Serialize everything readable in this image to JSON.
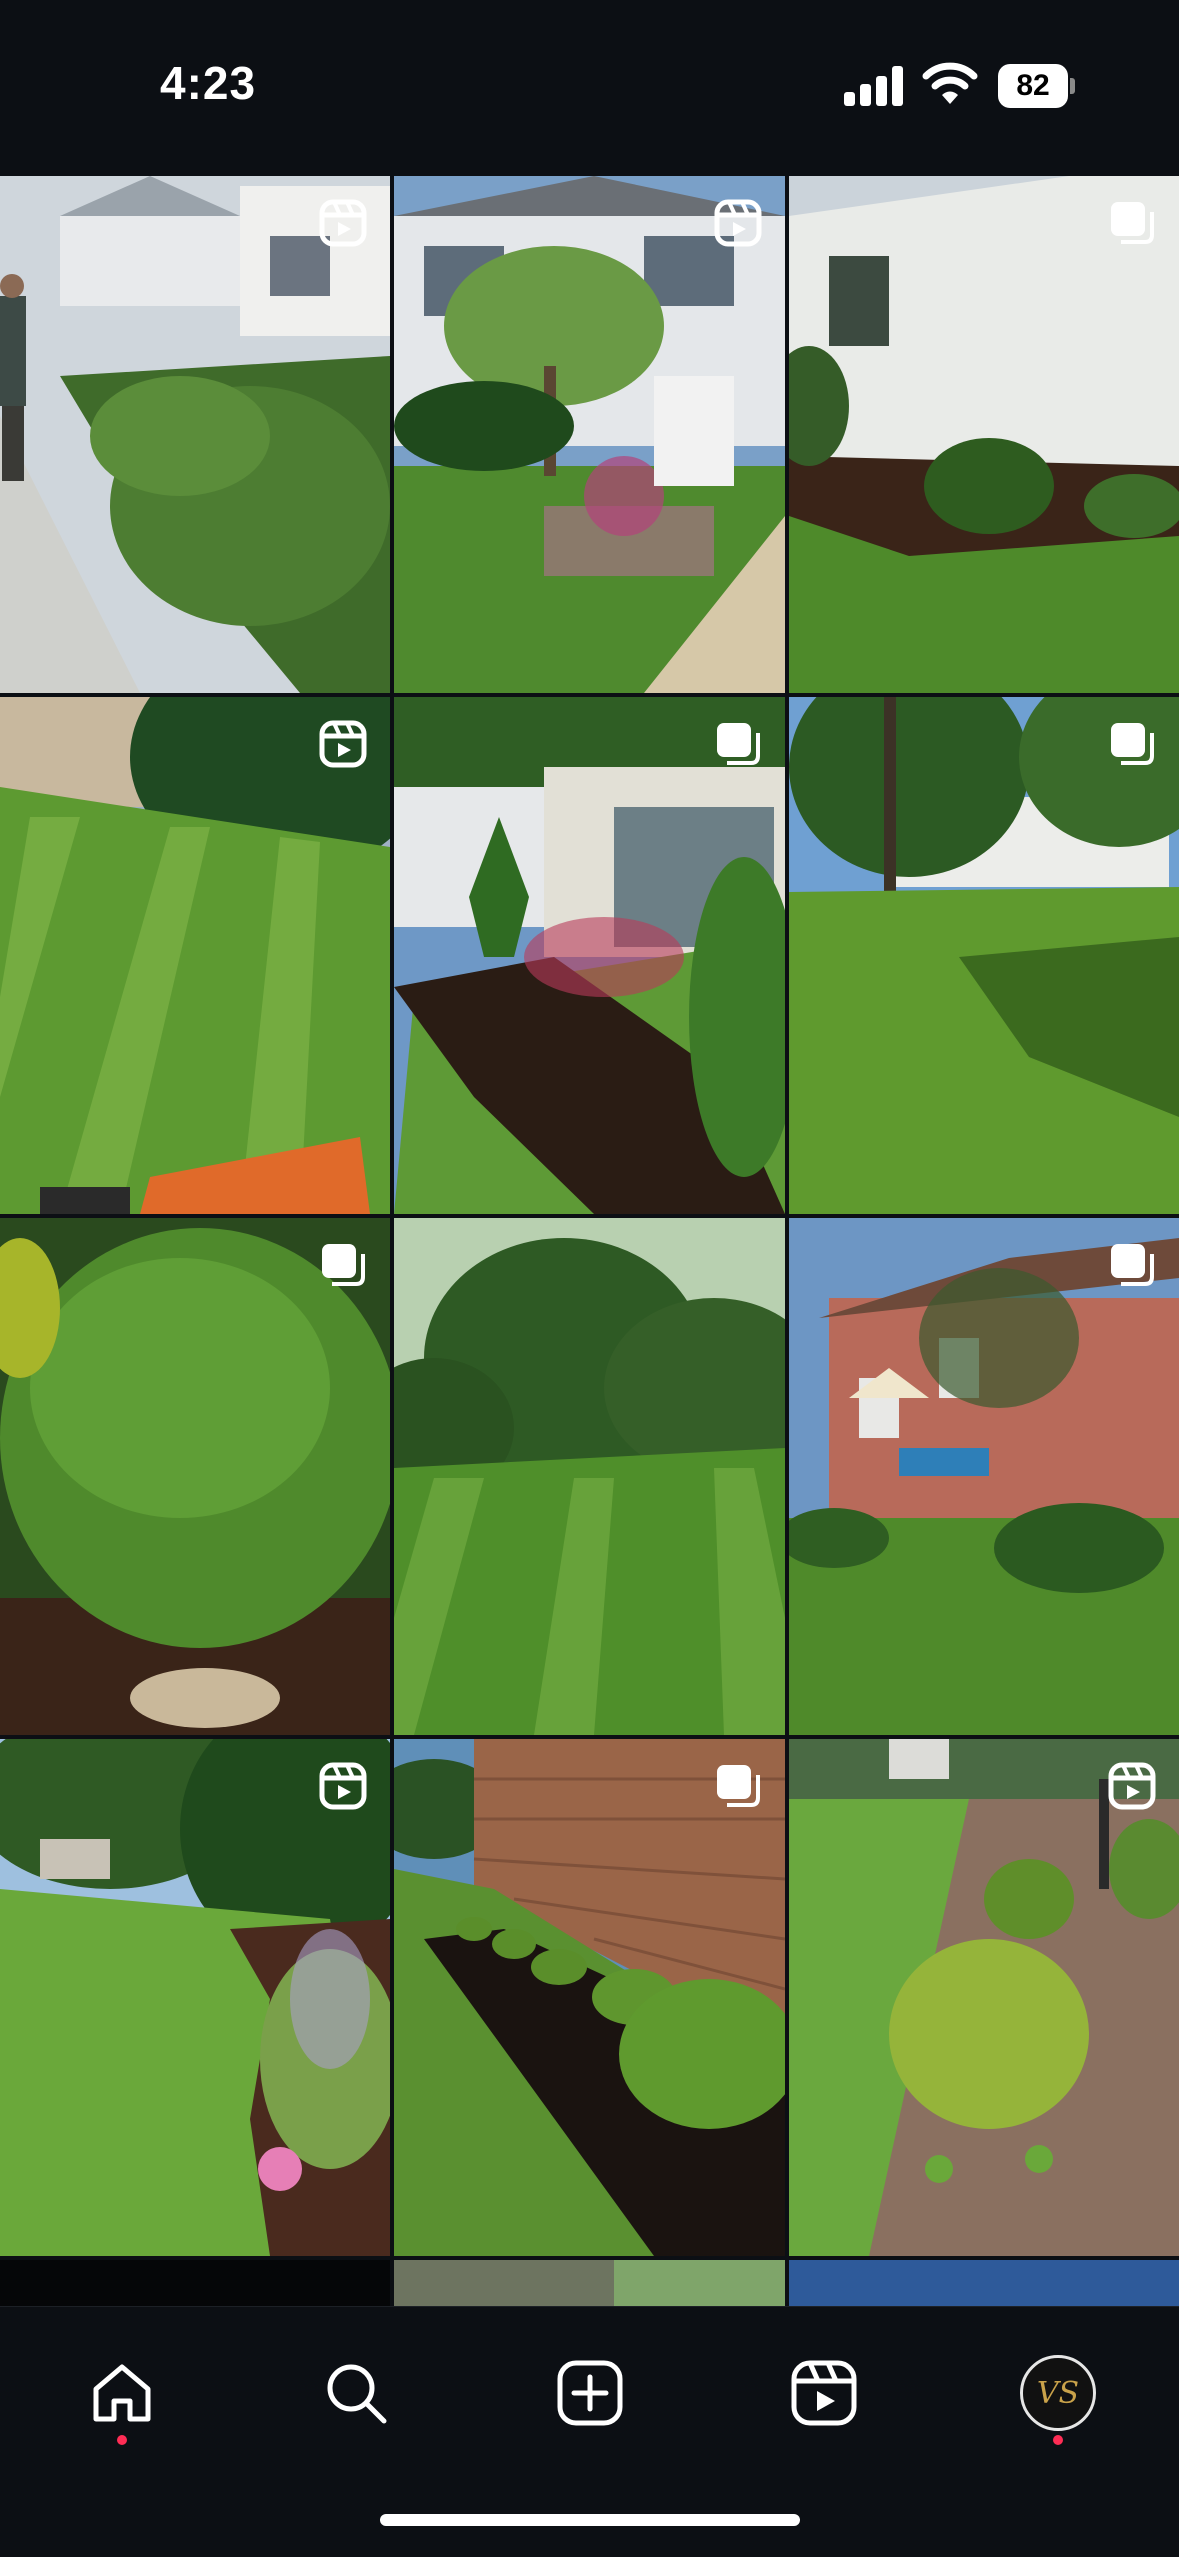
{
  "status_bar": {
    "time": "4:23",
    "battery_level": "82"
  },
  "grid": {
    "tiles": [
      {
        "badge": "reels-icon",
        "scene": "hedge-sidewalk"
      },
      {
        "badge": "reels-icon",
        "scene": "house-tree-front"
      },
      {
        "badge": "carousel-icon",
        "scene": "white-siding-shrub"
      },
      {
        "badge": "reels-icon",
        "scene": "striped-lawn-trees"
      },
      {
        "badge": "carousel-icon",
        "scene": "house-mulch-bed"
      },
      {
        "badge": "carousel-icon",
        "scene": "lawn-house-shade"
      },
      {
        "badge": "carousel-icon",
        "scene": "evergreen-shrub"
      },
      {
        "badge": "none",
        "scene": "striped-lawn-pines"
      },
      {
        "badge": "carousel-icon",
        "scene": "brick-house-shrubs"
      },
      {
        "badge": "reels-icon",
        "scene": "curved-garden-bed"
      },
      {
        "badge": "carousel-icon",
        "scene": "brick-wall-boxwoods"
      },
      {
        "badge": "reels-icon",
        "scene": "round-shrub-bed"
      }
    ]
  },
  "bottom_nav": {
    "items": [
      "home-icon",
      "search-icon",
      "create-icon",
      "reels-icon",
      "profile-avatar"
    ],
    "avatar_monogram": "VS"
  },
  "colors": {
    "background": "#0c0f14",
    "notification_dot": "#ff2d55",
    "avatar_gold": "#c9a24a"
  }
}
